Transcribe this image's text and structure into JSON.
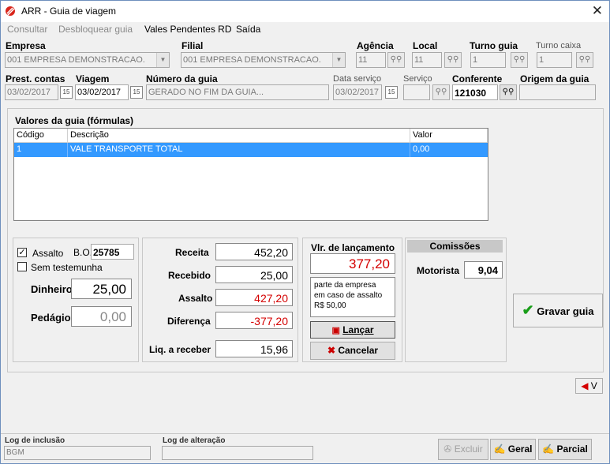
{
  "window": {
    "title": "ARR - Guia de viagem",
    "close_glyph": "✕"
  },
  "menu": {
    "consultar": "Consultar",
    "desbloquear": "Desbloquear guia",
    "vales": "Vales Pendentes RD",
    "saida": "Saída"
  },
  "header": {
    "empresa_label": "Empresa",
    "empresa_value": "001 EMPRESA DEMONSTRACAO.",
    "filial_label": "Filial",
    "filial_value": "001 EMPRESA DEMONSTRACAO.",
    "agencia_label": "Agência",
    "agencia_value": "11",
    "local_label": "Local",
    "local_value": "11",
    "turno_guia_label": "Turno guia",
    "turno_guia_value": "1",
    "turno_caixa_label": "Turno caixa",
    "turno_caixa_value": "1",
    "prest_label": "Prest. contas",
    "prest_value": "03/02/2017",
    "viagem_label": "Viagem",
    "viagem_value": "03/02/2017",
    "numero_label": "Número da guia",
    "numero_value": "GERADO NO FIM DA GUIA...",
    "data_servico_label": "Data serviço",
    "data_servico_value": "03/02/2017",
    "servico_label": "Serviço",
    "servico_value": "",
    "conferente_label": "Conferente",
    "conferente_value": "121030",
    "origem_label": "Origem da guia",
    "origem_value": ""
  },
  "valores": {
    "title": "Valores da guia (fórmulas)",
    "columns": [
      "Código",
      "Descrição",
      "Valor"
    ],
    "rows": [
      {
        "codigo": "1",
        "descricao": "VALE TRANSPORTE TOTAL",
        "valor": "0,00"
      }
    ]
  },
  "left_panel": {
    "assalto_label": "Assalto",
    "assalto_checked": true,
    "assalto_mark": "✓",
    "bo_label": "B.O.",
    "bo_value": "25785",
    "sem_testemunha_label": "Sem testemunha",
    "sem_testemunha_checked": false,
    "dinheiro_label": "Dinheiro",
    "dinheiro_value": "25,00",
    "pedagio_label": "Pedágio",
    "pedagio_value": "0,00"
  },
  "totals": {
    "receita_label": "Receita",
    "receita_value": "452,20",
    "recebido_label": "Recebido",
    "recebido_value": "25,00",
    "assalto_label": "Assalto",
    "assalto_value": "427,20",
    "diferenca_label": "Diferença",
    "diferenca_value": "-377,20",
    "liq_label": "Liq. a receber",
    "liq_value": "15,96"
  },
  "lancamento": {
    "title": "Vlr. de lançamento",
    "value": "377,20",
    "note_line1": "parte da empresa",
    "note_line2": "em caso de assalto",
    "note_line3": "R$ 50,00",
    "lancar_label": "Lançar",
    "cancelar_label": "Cancelar"
  },
  "comissoes": {
    "title": "Comissões",
    "motorista_label": "Motorista",
    "motorista_value": "9,04"
  },
  "actions": {
    "gravar_label": "Gravar guia",
    "v_label": "V",
    "excluir_label": "Excluir",
    "geral_label": "Geral",
    "parcial_label": "Parcial"
  },
  "status": {
    "log_inclusao_label": "Log de inclusão",
    "log_inclusao_value": "BGM",
    "log_alteracao_label": "Log de alteração",
    "log_alteracao_value": ""
  },
  "colors": {
    "accent": "#3399ff",
    "red": "#d40000",
    "green": "#1a9e1a"
  }
}
